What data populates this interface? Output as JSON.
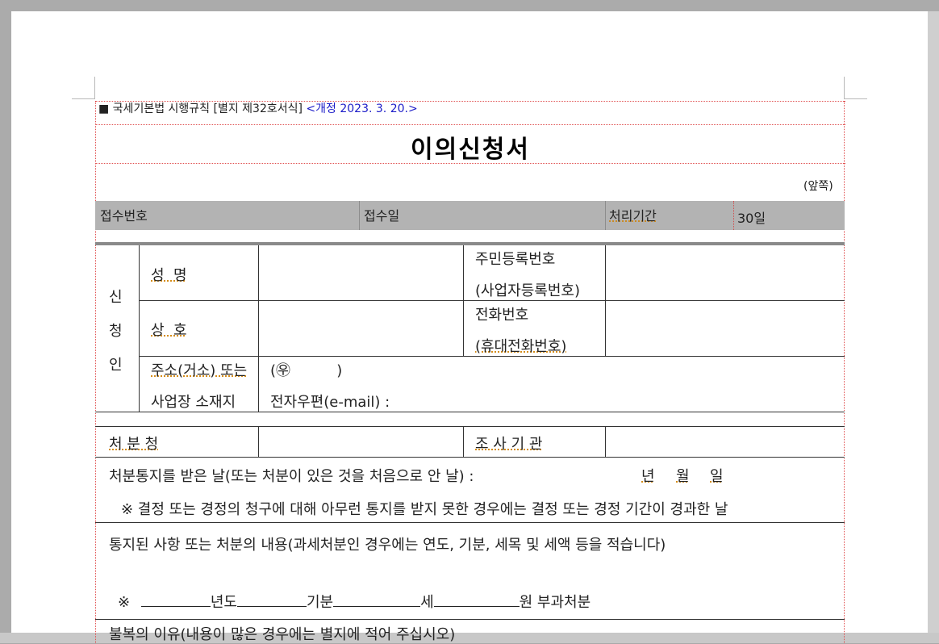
{
  "header": {
    "law_ref": "■ 국세기본법 시행규칙 [별지 제32호서식]",
    "revision": "<개정 2023. 3. 20.>"
  },
  "form": {
    "title": "이의신청서",
    "page_side": "(앞쪽)"
  },
  "receipt": {
    "receipt_no_label": "접수번호",
    "receipt_date_label": "접수일",
    "processing_period_label": "처리기간",
    "processing_period_value": "30일"
  },
  "applicant": {
    "section_label": [
      "신",
      "청",
      "인"
    ],
    "name_label": "성  명",
    "resident_no_label_1": "주민등록번호",
    "resident_no_label_2": "(사업자등록번호)",
    "trade_name_label": "상  호",
    "phone_label_1": "전화번호",
    "phone_label_2": "(휴대전화번호)",
    "address_label_1": "주소(거소) 또는",
    "address_label_2": "사업장 소재지",
    "postal_prefix": "(㉾          )",
    "email_label": "전자우편(e-mail) :"
  },
  "disposition": {
    "office_label": "처 분 청",
    "investigator_label": "조 사 기 관",
    "notice_date_label": "처분통지를 받은 날(또는 처분이 있은 것을 처음으로 안 날) :",
    "year": "년",
    "month": "월",
    "day": "일",
    "note": "※ 결정 또는 경정의 청구에 대해 아무런 통지를 받지 못한 경우에는 결정 또는 경정 기간이 경과한 날",
    "content_label": "통지된 사항 또는 처분의 내용(과세처분인 경우에는 연도, 기분, 세목 및 세액 등을 적습니다)",
    "mark": "※",
    "year_unit": "년도",
    "period_unit": "기분",
    "tax_unit": "세",
    "won_unit": "원 부과처분",
    "reason_label": "불복의 이유(내용이 많은 경우에는 별지에 적어 주십시오)"
  }
}
